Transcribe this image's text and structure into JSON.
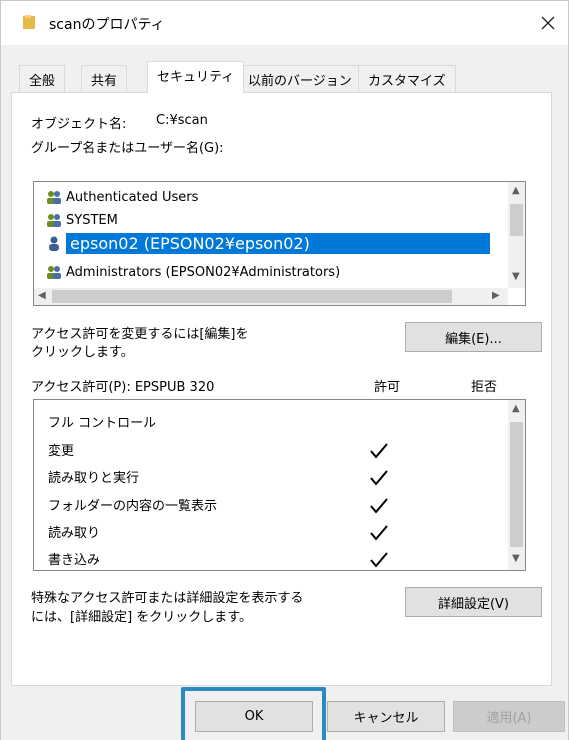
{
  "window": {
    "title": "scanのプロパティ"
  },
  "tabs": [
    {
      "label": "全般"
    },
    {
      "label": "共有"
    },
    {
      "label": "セキュリティ"
    },
    {
      "label": "以前のバージョン"
    },
    {
      "label": "カスタマイズ"
    }
  ],
  "security": {
    "object_name_label": "オブジェクト名:",
    "object_name_value": "C:¥scan",
    "group_label": "グループ名またはユーザー名(G):",
    "groups": [
      {
        "name": "Authenticated Users",
        "icon": "user-group-icon"
      },
      {
        "name": "SYSTEM",
        "icon": "user-group-icon"
      },
      {
        "name": "epson02 (EPSON02¥epson02)",
        "icon": "user-icon"
      },
      {
        "name": "Administrators (EPSON02¥Administrators)",
        "icon": "user-group-icon"
      }
    ],
    "edit_hint": "アクセス許可を変更するには[編集]を",
    "edit_hint2": "クリックします。",
    "edit_button": "編集(E)...",
    "perm_label": "アクセス許可(P): EPSPUB 320",
    "allow_header": "許可",
    "deny_header": "拒否",
    "permissions": [
      {
        "name": "フル コントロール",
        "allow": false
      },
      {
        "name": "変更",
        "allow": true
      },
      {
        "name": "読み取りと実行",
        "allow": true
      },
      {
        "name": "フォルダーの内容の一覧表示",
        "allow": true
      },
      {
        "name": "読み取り",
        "allow": true
      },
      {
        "name": "書き込み",
        "allow": true
      }
    ],
    "advanced_hint": "特殊なアクセス許可または詳細設定を表示する",
    "advanced_hint2": "には、[詳細設定] をクリックします。",
    "advanced_button": "詳細設定(V)"
  },
  "footer": {
    "ok": "OK",
    "cancel": "キャンセル",
    "apply": "適用(A)"
  },
  "colors": {
    "selection": "#0078d7",
    "highlight": "#2a8ac4",
    "folder": "#e8b84a"
  }
}
